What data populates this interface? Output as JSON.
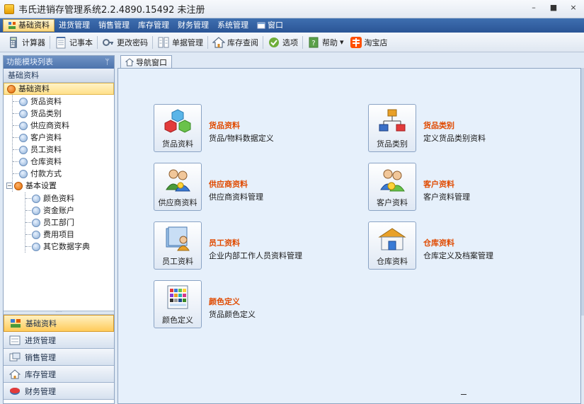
{
  "window": {
    "title": "韦氏进销存管理系统2.2.4890.15492 未注册",
    "controls": [
      "–",
      "■",
      "×"
    ]
  },
  "menubar": {
    "items": [
      {
        "label": "基础资料",
        "active": true
      },
      {
        "label": "进货管理"
      },
      {
        "label": "销售管理"
      },
      {
        "label": "库存管理"
      },
      {
        "label": "财务管理"
      },
      {
        "label": "系统管理"
      },
      {
        "label": "窗口"
      }
    ]
  },
  "toolbar": {
    "items": [
      {
        "label": "计算器",
        "icon": "calculator-icon"
      },
      {
        "label": "记事本",
        "icon": "notepad-icon"
      },
      {
        "label": "更改密码",
        "icon": "key-icon"
      },
      {
        "label": "单据管理",
        "icon": "document-icon"
      },
      {
        "label": "库存查阅",
        "icon": "house-icon"
      },
      {
        "label": "选项",
        "icon": "options-icon"
      },
      {
        "label": "帮助",
        "icon": "help-icon"
      },
      {
        "label": "淘宝店",
        "icon": "taobao-icon"
      }
    ]
  },
  "leftpanel": {
    "header": "功能模块列表",
    "pin": "ᛘ",
    "section": "基础资料",
    "tree": {
      "root": "基础资料",
      "items": [
        "货品资料",
        "货品类别",
        "供应商资料",
        "客户资料",
        "员工资料",
        "仓库资料",
        "付款方式"
      ],
      "group": "基本设置",
      "sub_items": [
        "颜色资料",
        "资金账户",
        "员工部门",
        "费用项目",
        "其它数据字典"
      ]
    },
    "nav": [
      {
        "label": "基础资料",
        "active": true
      },
      {
        "label": "进货管理"
      },
      {
        "label": "销售管理"
      },
      {
        "label": "库存管理"
      },
      {
        "label": "财务管理"
      }
    ]
  },
  "tab": {
    "label": "导航窗口"
  },
  "cards": [
    {
      "label": "货品资料",
      "title": "货品资料",
      "desc": "货品/物料数据定义",
      "icon": "cubes-icon"
    },
    {
      "label": "货品类别",
      "title": "货品类别",
      "desc": "定义货品类别资料",
      "icon": "hierarchy-icon"
    },
    {
      "label": "供应商资料",
      "title": "供应商资料",
      "desc": "供应商资料管理",
      "icon": "supplier-icon"
    },
    {
      "label": "客户资料",
      "title": "客户资料",
      "desc": "客户资料管理",
      "icon": "customer-icon"
    },
    {
      "label": "员工资料",
      "title": "员工资料",
      "desc": "企业内部工作人员资料管理",
      "icon": "employee-icon"
    },
    {
      "label": "仓库资料",
      "title": "仓库资料",
      "desc": "仓库定义及档案管理",
      "icon": "warehouse-icon"
    },
    {
      "label": "颜色定义",
      "title": "颜色定义",
      "desc": "货品颜色定义",
      "icon": "color-palette-icon"
    }
  ],
  "colors": {
    "menubar": "#2f5c9c",
    "accent_title": "#e04a00",
    "active_gold": "#ffd77a"
  }
}
